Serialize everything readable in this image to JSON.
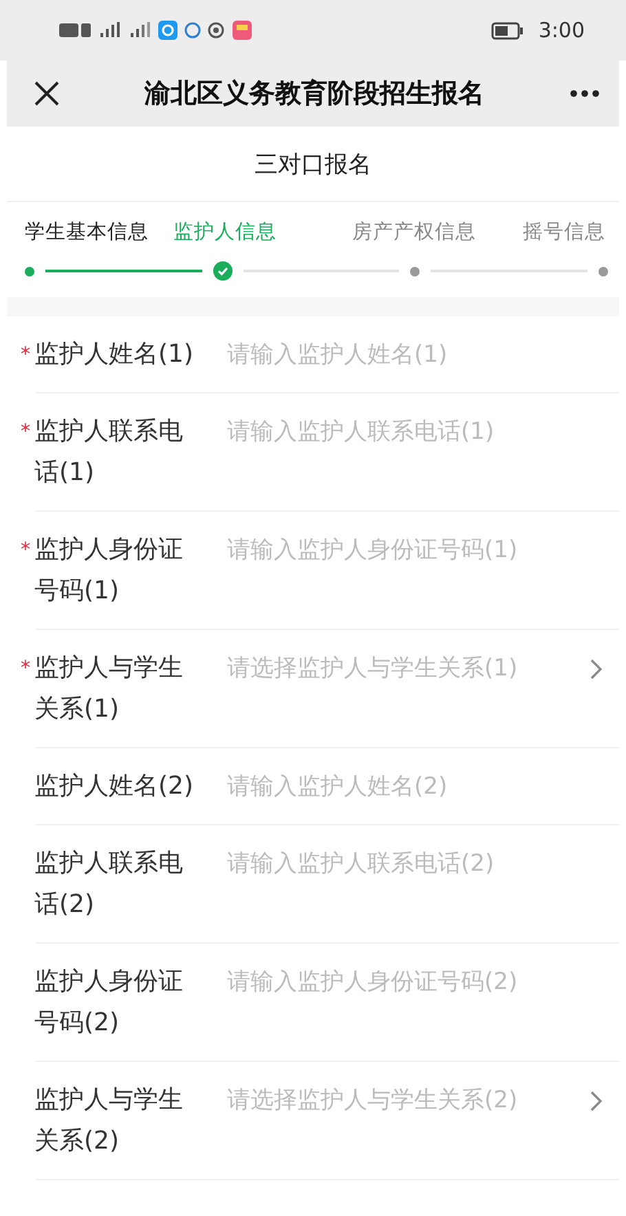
{
  "status_bar": {
    "time": "3:00"
  },
  "nav": {
    "title": "渝北区义务教育阶段招生报名"
  },
  "subtitle": "三对口报名",
  "steps": [
    {
      "label": "学生基本信息",
      "done": true,
      "selected": false
    },
    {
      "label": "监护人信息",
      "done": false,
      "selected": true
    },
    {
      "label": "房产产权信息",
      "done": false,
      "selected": false
    },
    {
      "label": "摇号信息",
      "done": false,
      "selected": false
    }
  ],
  "fields": [
    {
      "label": "监护人姓名(1)",
      "placeholder": "请输入监护人姓名(1)",
      "star": "*",
      "kind": "input"
    },
    {
      "label": "监护人联系电话(1)",
      "placeholder": "请输入监护人联系电话(1)",
      "star": "*",
      "kind": "input"
    },
    {
      "label": "监护人身份证号码(1)",
      "placeholder": "请输入监护人身份证号码(1)",
      "star": "*",
      "kind": "input"
    },
    {
      "label": "监护人与学生关系(1)",
      "placeholder": "请选择监护人与学生关系(1)",
      "star": "*",
      "kind": "select"
    },
    {
      "label": "监护人姓名(2)",
      "placeholder": "请输入监护人姓名(2)",
      "kind": "input"
    },
    {
      "label": "监护人联系电话(2)",
      "placeholder": "请输入监护人联系电话(2)",
      "kind": "input"
    },
    {
      "label": "监护人身份证号码(2)",
      "placeholder": "请输入监护人身份证号码(2)",
      "kind": "input"
    },
    {
      "label": "监护人与学生关系(2)",
      "placeholder": "请选择监护人与学生关系(2)",
      "kind": "select"
    }
  ]
}
